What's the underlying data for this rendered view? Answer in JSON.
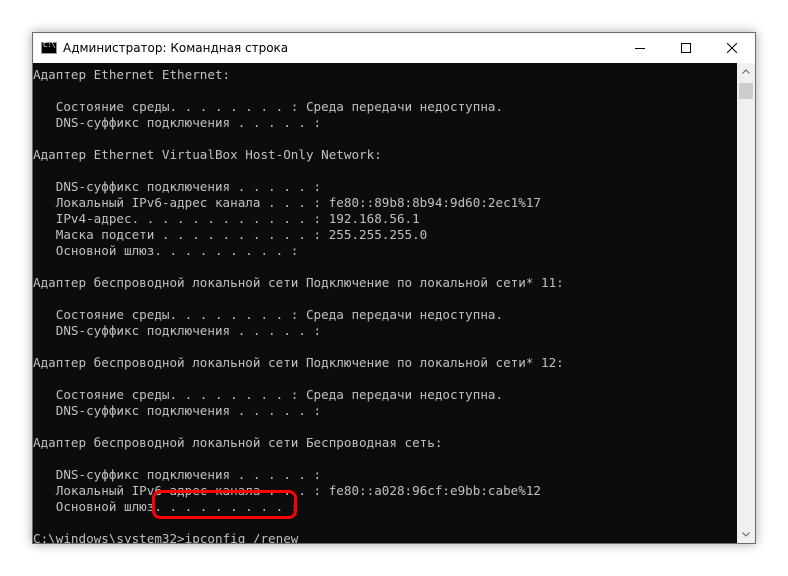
{
  "window": {
    "title": "Администратор: Командная строка",
    "icon_text": "C:\\",
    "controls": [
      "minimize-icon",
      "maximize-icon",
      "close-icon"
    ]
  },
  "console": {
    "lines": [
      "Адаптер Ethernet Ethernet:",
      "",
      "   Состояние среды. . . . . . . . : Среда передачи недоступна.",
      "   DNS-суффикс подключения . . . . . :",
      "",
      "Адаптер Ethernet VirtualBox Host-Only Network:",
      "",
      "   DNS-суффикс подключения . . . . . :",
      "   Локальный IPv6-адрес канала . . . : fe80::89b8:8b94:9d60:2ec1%17",
      "   IPv4-адрес. . . . . . . . . . . . : 192.168.56.1",
      "   Маска подсети . . . . . . . . . . : 255.255.255.0",
      "   Основной шлюз. . . . . . . . . :",
      "",
      "Адаптер беспроводной локальной сети Подключение по локальной сети* 11:",
      "",
      "   Состояние среды. . . . . . . . : Среда передачи недоступна.",
      "   DNS-суффикс подключения . . . . . :",
      "",
      "Адаптер беспроводной локальной сети Подключение по локальной сети* 12:",
      "",
      "   Состояние среды. . . . . . . . : Среда передачи недоступна.",
      "   DNS-суффикс подключения . . . . . :",
      "",
      "Адаптер беспроводной локальной сети Беспроводная сеть:",
      "",
      "   DNS-суффикс подключения . . . . . :",
      "   Локальный IPv6-адрес канала . . . : fe80::a028:96cf:e9bb:cabe%12",
      "   Основной шлюз. . . . . . . . . :",
      ""
    ],
    "prompt": "C:\\windows\\system32>",
    "command": "ipconfig /renew"
  },
  "colors": {
    "console_bg": "#0c0c0c",
    "console_fg": "#c0c0c0",
    "highlight": "#ff0000"
  }
}
